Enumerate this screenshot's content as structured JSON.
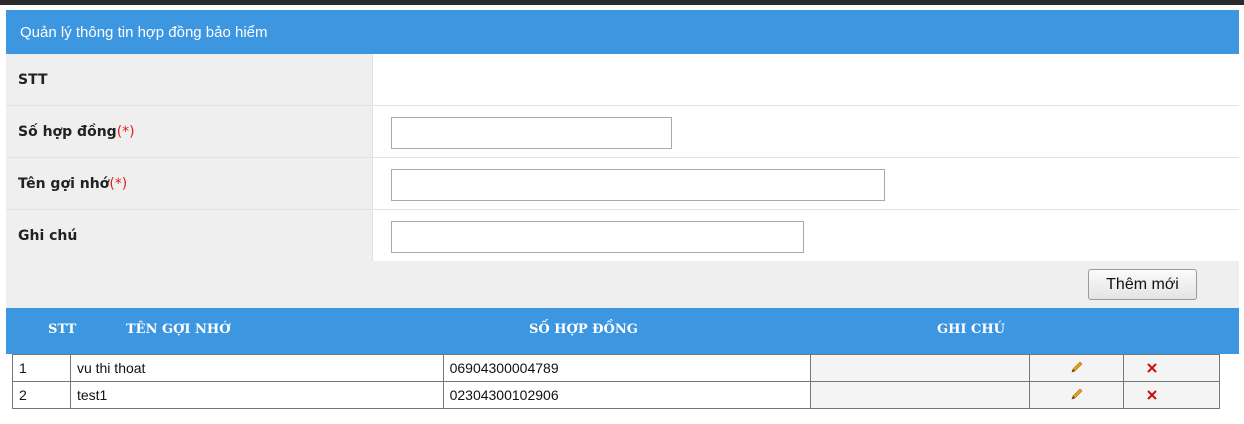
{
  "panel": {
    "title": "Quản lý thông tin hợp đồng bảo hiểm"
  },
  "form": {
    "stt_label": "STT",
    "so_hop_dong_label": "Số hợp đồng",
    "ten_goi_nho_label": "Tên gợi nhớ",
    "ghi_chu_label": "Ghi chú",
    "required_mark": "(*)",
    "so_hop_dong_value": "",
    "ten_goi_nho_value": "",
    "ghi_chu_value": ""
  },
  "buttons": {
    "add_new": "Thêm mới"
  },
  "table": {
    "headers": {
      "stt": "STT",
      "ten_goi_nho": "TÊN GỢI NHỚ",
      "so_hop_dong": "SỐ HỢP ĐỒNG",
      "ghi_chu": "GHI CHÚ"
    },
    "rows": [
      {
        "stt": "1",
        "ten_goi_nho": "vu thi thoat",
        "so_hop_dong": "06904300004789",
        "ghi_chu": ""
      },
      {
        "stt": "2",
        "ten_goi_nho": "test1",
        "so_hop_dong": "02304300102906",
        "ghi_chu": ""
      }
    ],
    "row_actions": [
      "edit-icon",
      "delete-icon"
    ]
  },
  "colors": {
    "header_blue": "#3d96e0",
    "required_red": "#e02020",
    "delete_red": "#cc1111",
    "edit_orange": "#e5a21a"
  }
}
